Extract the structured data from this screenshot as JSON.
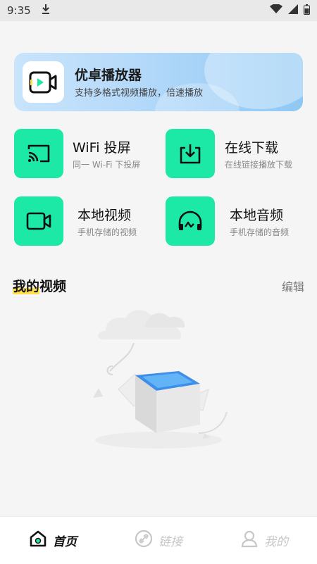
{
  "status_bar": {
    "time": "9:35"
  },
  "banner": {
    "title": "优卓播放器",
    "subtitle": "支持多格式视频播放，倍速播放"
  },
  "features": [
    {
      "title": "WiFi 投屏",
      "subtitle": "同一 Wi-Fi 下投屏",
      "icon": "cast-icon"
    },
    {
      "title": "在线下载",
      "subtitle": "在线链接播放下载",
      "icon": "download-icon"
    },
    {
      "title": "本地视频",
      "subtitle": "手机存储的视频",
      "icon": "video-camera-icon"
    },
    {
      "title": "本地音频",
      "subtitle": "手机存储的音频",
      "icon": "headphones-icon"
    }
  ],
  "my_videos": {
    "title_highlight": "我的",
    "title_rest": "视频",
    "edit_label": "编辑"
  },
  "bottom_nav": [
    {
      "label": "首页",
      "icon": "home-icon",
      "active": true
    },
    {
      "label": "链接",
      "icon": "link-icon",
      "active": false
    },
    {
      "label": "我的",
      "icon": "profile-icon",
      "active": false
    }
  ],
  "colors": {
    "accent": "#1de9a6",
    "highlight": "#ffe04a"
  }
}
